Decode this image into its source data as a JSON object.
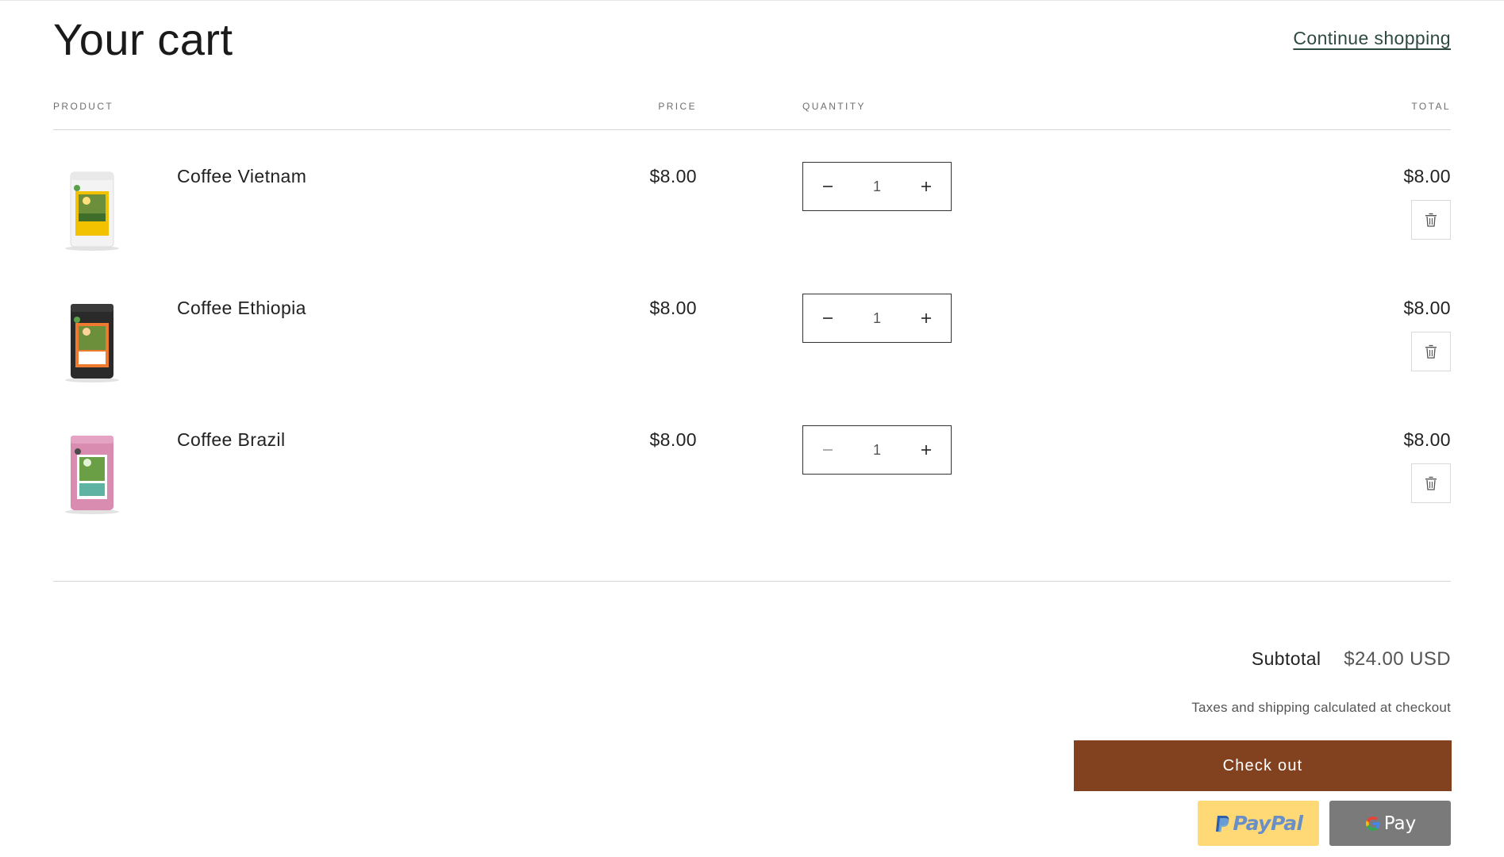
{
  "header": {
    "title": "Your cart",
    "continue_label": "Continue shopping"
  },
  "columns": {
    "product": "PRODUCT",
    "price": "PRICE",
    "quantity": "QUANTITY",
    "total": "TOTAL"
  },
  "items": [
    {
      "name": "Coffee Vietnam",
      "price": "$8.00",
      "quantity": "1",
      "total": "$8.00",
      "bag_color": "#f3f3f3",
      "label_color": "#f2c100"
    },
    {
      "name": "Coffee Ethiopia",
      "price": "$8.00",
      "quantity": "1",
      "total": "$8.00",
      "bag_color": "#2a2a2a",
      "label_color": "#ee7b2f"
    },
    {
      "name": "Coffee Brazil",
      "price": "$8.00",
      "quantity": "1",
      "total": "$8.00",
      "bag_color": "#d98bb0",
      "label_color": "#5fb3a2"
    }
  ],
  "icons": {
    "decrease": "minus-icon",
    "increase": "plus-icon",
    "remove": "trash-icon"
  },
  "summary": {
    "subtotal_label": "Subtotal",
    "subtotal_value": "$24.00 USD",
    "tax_note": "Taxes and shipping calculated at checkout",
    "checkout_label": "Check out",
    "paypal_label": "PayPal",
    "gpay_label": "Pay"
  },
  "colors": {
    "checkout": "#82421f",
    "paypal": "#ffd976",
    "gpay": "#7a7a7a",
    "link": "#2f4a43"
  }
}
